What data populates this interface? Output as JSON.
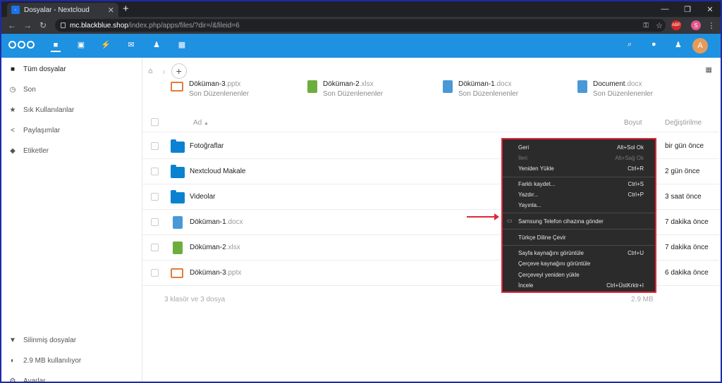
{
  "browser": {
    "tab_title": "Dosyalar - Nextcloud",
    "new_tab": "+",
    "url_domain": "mc.blackblue.shop",
    "url_path": "/index.php/apps/files/?dir=/&fileid=6",
    "profile_initial": "S",
    "abp_label": "ABP"
  },
  "header": {
    "avatar_initial": "A"
  },
  "sidebar": {
    "items": [
      {
        "label": "Tüm dosyalar",
        "icon": "folder-icon"
      },
      {
        "label": "Son",
        "icon": "clock-icon"
      },
      {
        "label": "Sık Kullanılanlar",
        "icon": "star-icon"
      },
      {
        "label": "Paylaşımlar",
        "icon": "share-icon"
      },
      {
        "label": "Etiketler",
        "icon": "tag-icon"
      }
    ],
    "bottom": [
      {
        "label": "Silinmiş dosyalar",
        "icon": "trash-icon"
      },
      {
        "label": "2.9 MB kullanılıyor",
        "icon": "quota-icon"
      },
      {
        "label": "Ayarlar",
        "icon": "gear-icon"
      }
    ]
  },
  "recent": [
    {
      "name": "Döküman-3",
      "ext": ".pptx",
      "sub": "Son Düzenlenenler",
      "type": "pptx"
    },
    {
      "name": "Döküman-2",
      "ext": ".xlsx",
      "sub": "Son Düzenlenenler",
      "type": "xlsx"
    },
    {
      "name": "Döküman-1",
      "ext": ".docx",
      "sub": "Son Düzenlenenler",
      "type": "docx"
    },
    {
      "name": "Document",
      "ext": ".docx",
      "sub": "Son Düzenlenenler",
      "type": "docx"
    }
  ],
  "table": {
    "col_name": "Ad",
    "col_size": "Boyut",
    "col_modified": "Değiştirilme",
    "rows": [
      {
        "name": "Fotoğraflar",
        "ext": "",
        "type": "folder",
        "modified": "bir gün önce"
      },
      {
        "name": "Nextcloud Makale",
        "ext": "",
        "type": "folder",
        "modified": "2 gün önce"
      },
      {
        "name": "Videolar",
        "ext": "",
        "type": "folder",
        "modified": "3 saat önce"
      },
      {
        "name": "Döküman-1",
        "ext": ".docx",
        "type": "docx",
        "modified": "7 dakika önce"
      },
      {
        "name": "Döküman-2",
        "ext": ".xlsx",
        "type": "xlsx",
        "modified": "7 dakika önce"
      },
      {
        "name": "Döküman-3",
        "ext": ".pptx",
        "type": "pptx",
        "modified": "6 dakika önce"
      }
    ],
    "summary": "3 klasör ve 3 dosya",
    "summary_size": "2.9 MB"
  },
  "context_menu": {
    "items": [
      {
        "label": "Geri",
        "shortcut": "Alt+Sol Ok",
        "disabled": false
      },
      {
        "label": "İleri",
        "shortcut": "Alt+Sağ Ok",
        "disabled": true
      },
      {
        "label": "Yeniden Yükle",
        "shortcut": "Ctrl+R",
        "disabled": false
      },
      {
        "label": "Farklı kaydet...",
        "shortcut": "Ctrl+S",
        "disabled": false
      },
      {
        "label": "Yazdır...",
        "shortcut": "Ctrl+P",
        "disabled": false
      },
      {
        "label": "Yayınla...",
        "shortcut": "",
        "disabled": false
      },
      {
        "label": "Samsung Telefon cihazına gönder",
        "shortcut": "",
        "disabled": false
      },
      {
        "label": "Türkçe Diline Çevir",
        "shortcut": "",
        "disabled": false
      },
      {
        "label": "Sayfa kaynağını görüntüle",
        "shortcut": "Ctrl+U",
        "disabled": false
      },
      {
        "label": "Çerçeve kaynağını görüntüle",
        "shortcut": "",
        "disabled": false
      },
      {
        "label": "Çerçeveyi yeniden yükle",
        "shortcut": "",
        "disabled": false
      },
      {
        "label": "İncele",
        "shortcut": "Ctrl+ÜstKrktr+I",
        "disabled": false
      }
    ]
  },
  "colors": {
    "header_blue": "#1e91e0",
    "folder_blue": "#0b82d1",
    "highlight_red": "#e0263a"
  }
}
